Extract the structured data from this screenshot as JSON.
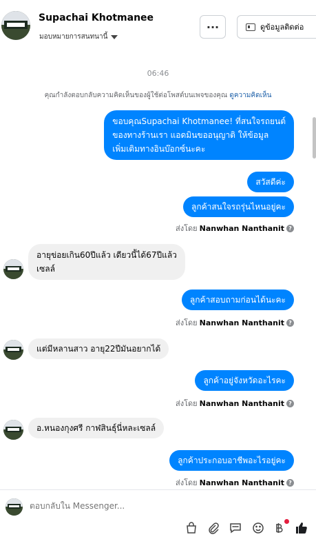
{
  "header": {
    "name": "Supachai Khotmanee",
    "assign_label": "มอบหมายการสนทนานี้",
    "more_label": "···",
    "contact_label": "ดูข้อมูลติดต่อ"
  },
  "chat": {
    "timestamp": "06:46",
    "notice_text": "คุณกำลังตอบกลับความคิดเห็นของผู้ใช้ต่อโพสต์บนเพจของคุณ",
    "notice_link": "ดูความคิดเห็น",
    "messages": [
      {
        "dir": "out",
        "lines": [
          "ขอบคุณSupachai Khotmanee! ที่สนใจรถยนต์",
          "ของทางร้านเรา แอดมินขออนุญาติ ให้ข้อมูล",
          "เพิ่มเติมทางอินบ๊อกซ์นะคะ"
        ]
      },
      {
        "dir": "out",
        "text": "สวัสดีค่ะ"
      },
      {
        "dir": "out",
        "text": "ลูกค้าสนใจรถรุ่นไหนอยู่คะ"
      },
      {
        "dir": "in",
        "lines": [
          "อายุข่อยเกิน60ปีแล้ว เดียวนี้ได้67ปีแล้ว",
          "เซลล์"
        ]
      },
      {
        "dir": "out",
        "text": "ลูกค้าสอบถามก่อนได้นะคะ"
      },
      {
        "dir": "in",
        "text": "แต่มีหลานสาว อายุ22ปีมันอยากได้"
      },
      {
        "dir": "out",
        "text": "ลูกค้าอยู่จังหวัดอะไรคะ"
      },
      {
        "dir": "in",
        "text": "อ.หนองกุงศรี กาฬสินธุ์นี่หละเซลล์"
      },
      {
        "dir": "out",
        "text": "ลูกค้าประกอบอาชีพอะไรอยู่คะ"
      }
    ],
    "sent_by_prefix": "ส่งโดย",
    "sent_by_name": "Nanwhan Nanthanit"
  },
  "composer": {
    "placeholder": "ตอบกลับใน Messenger..."
  },
  "icons": [
    "shopping-bag-icon",
    "paperclip-icon",
    "chat-template-icon",
    "emoji-icon",
    "baht-icon",
    "thumbs-up-icon"
  ],
  "colors": {
    "accent": "#0084ff",
    "incoming": "#f0f0f0",
    "like": "#1c1e21",
    "badge": "#e41e3f"
  }
}
